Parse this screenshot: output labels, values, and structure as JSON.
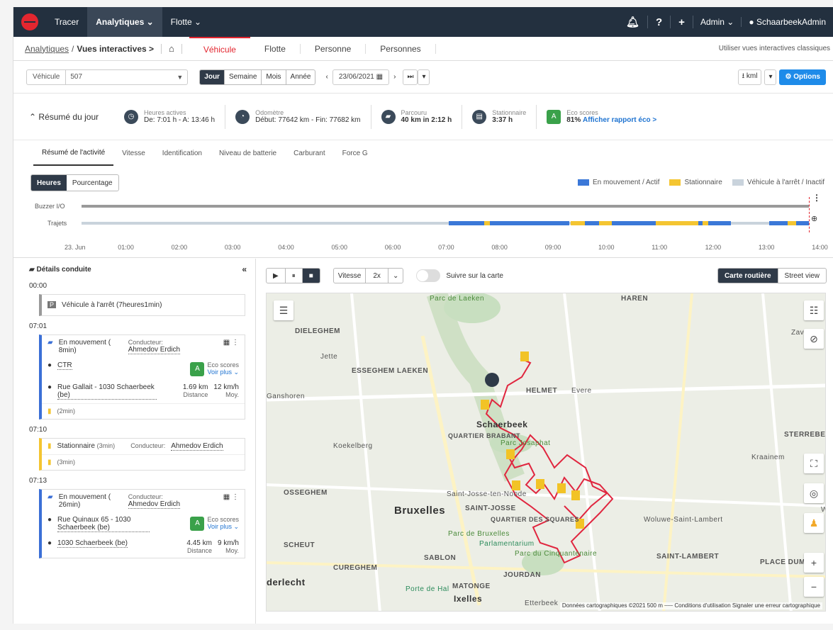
{
  "nav": {
    "items": [
      "Tracer",
      "Analytiques ⌄",
      "Flotte ⌄"
    ],
    "admin": "Admin ⌄",
    "user": "SchaarbeekAdmin"
  },
  "subnav": {
    "crumb_root": "Analytiques",
    "crumb_current": "Vues interactives >",
    "tabs": [
      "Véhicule",
      "Flotte",
      "Personne",
      "Personnes"
    ],
    "classic_link": "Utiliser vues interactives classiques"
  },
  "filters": {
    "vehicle_label": "Véhicule",
    "vehicle_value": "507",
    "periods": [
      "Jour",
      "Semaine",
      "Mois",
      "Année"
    ],
    "date": "23/06/2021",
    "export": "⭳ kml",
    "options": "⚙ Options"
  },
  "summary": {
    "title": "Résumé du jour",
    "active_label": "Heures actives",
    "active_value": "De: 7:01 h - A: 13:46 h",
    "odo_label": "Odomètre",
    "odo_value": "Début: 77642 km - Fin: 77682 km",
    "route_label": "Parcouru",
    "route_value": "40 km in 2:12 h",
    "park_label": "Stationnaire",
    "park_value": "3:37 h",
    "eco_label": "Eco scores",
    "eco_value": "81%",
    "eco_link": "Afficher rapport éco >"
  },
  "activity_tabs": [
    "Résumé de l'activité",
    "Vitesse",
    "Identification",
    "Niveau de batterie",
    "Carburant",
    "Force G"
  ],
  "timeline": {
    "toggle": [
      "Heures",
      "Pourcentage"
    ],
    "legend": [
      "En mouvement / Actif",
      "Stationnaire",
      "Véhicule à l'arrêt / Inactif"
    ],
    "rows": [
      "Buzzer I/O",
      "Trajets"
    ],
    "hours": [
      "23. Jun",
      "01:00",
      "02:00",
      "03:00",
      "04:00",
      "05:00",
      "06:00",
      "07:00",
      "08:00",
      "09:00",
      "10:00",
      "11:00",
      "12:00",
      "13:00",
      "14:00"
    ],
    "colors": {
      "moving": "#3b78d8",
      "parked": "#f4c531",
      "idle": "#c9d3dc"
    }
  },
  "details": {
    "title": "Détails conduite",
    "t0": "00:00",
    "idle": "Véhicule à l'arrêt (7heures1min)",
    "t1": "07:01",
    "move1": "En mouvement ( 8min)",
    "driver_label": "Conducteur:",
    "driver": "Ahmedov Erdich",
    "ctr": "CTR",
    "eco": "Eco scores",
    "eco_more": "Voir plus ⌄",
    "addr1": "Rue Gallait - 1030 Schaerbeek (be)",
    "dist1": "1.69 km",
    "speed1": "12 km/h",
    "dist_label": "Distance",
    "speed_label": "Moy.",
    "stop1": "(2min)",
    "t2": "07:10",
    "park": "Stationnaire",
    "park_dur": "(3min)",
    "stop2": "(3min)",
    "t3": "07:13",
    "move2": "En mouvement ( 26min)",
    "addr2": "Rue Quinaux 65 - 1030 Schaerbeek (be)",
    "addr3": "1030 Schaerbeek (be)",
    "dist2": "4.45 km",
    "speed2": "9 km/h"
  },
  "mapbar": {
    "speed_label": "Vitesse",
    "speed_value": "2x",
    "follow": "Suivre sur la carte",
    "road": "Carte routière",
    "street": "Street view"
  },
  "map": {
    "labels": [
      "Parc de Laeken",
      "HAREN",
      "DIELEGHEM",
      "Jette",
      "ESSEGHEM LAEKEN",
      "Ganshoren",
      "HELMET",
      "Evere",
      "Schaerbeek",
      "QUARTIER BRABANT",
      "Parc Josaphat",
      "Koekelberg",
      "STERREBEEK",
      "Kraainem",
      "OSSEGHEM",
      "Saint-Josse-ten-Noode",
      "Bruxelles",
      "SAINT-JOSSE",
      "QUARTIER DES SQUARES",
      "Woluwe-Saint-Lambert",
      "SCHEUT",
      "Parc de Bruxelles",
      "Parlamentarium",
      "Parc du Cinquantenaire",
      "SAINT-LAMBERT",
      "PLACE DUMC",
      "SABLON",
      "CUREGHEM",
      "JOURDAN",
      "derlecht",
      "Porte de Hal",
      "MATONGE",
      "Ixelles",
      "Etterbeek",
      "Zaver",
      "W"
    ],
    "footer": "Données cartographiques ©2021   500 m ⎯⎯⎯   Conditions d'utilisation   Signaler une erreur cartographique"
  }
}
